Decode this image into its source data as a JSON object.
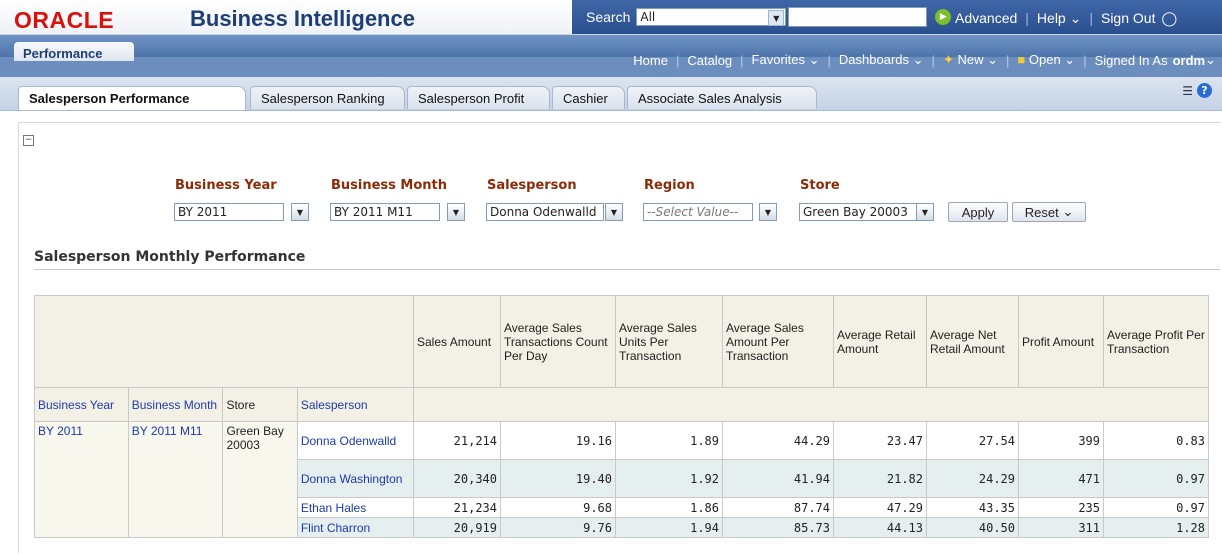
{
  "brand": {
    "logo": "ORACLE",
    "product": "Business Intelligence"
  },
  "search": {
    "label": "Search",
    "scope": "All",
    "value": ""
  },
  "top_links": {
    "advanced": "Advanced",
    "help": "Help",
    "sign_out": "Sign Out"
  },
  "nav": {
    "dashboard_title": "Performance",
    "home": "Home",
    "catalog": "Catalog",
    "favorites": "Favorites",
    "dashboards": "Dashboards",
    "new": "New",
    "open": "Open",
    "signed_in_as": "Signed In As",
    "user": "ordm"
  },
  "tabs": [
    {
      "label": "Salesperson Performance"
    },
    {
      "label": "Salesperson Ranking"
    },
    {
      "label": "Salesperson Profit"
    },
    {
      "label": "Cashier"
    },
    {
      "label": "Associate Sales Analysis"
    }
  ],
  "prompts": {
    "business_year": {
      "label": "Business Year",
      "value": "BY 2011"
    },
    "business_month": {
      "label": "Business Month",
      "value": "BY 2011 M11"
    },
    "salesperson": {
      "label": "Salesperson",
      "value": "Donna Odenwalld"
    },
    "region": {
      "label": "Region",
      "placeholder": "--Select Value--"
    },
    "store": {
      "label": "Store",
      "value": "Green Bay 20003"
    },
    "apply": "Apply",
    "reset": "Reset"
  },
  "section": {
    "title": "Salesperson Monthly Performance"
  },
  "table": {
    "measure_headers": [
      "Sales Amount",
      "Average Sales Transactions Count Per Day",
      "Average Sales Units Per Transaction",
      "Average Sales Amount Per Transaction",
      "Average Retail Amount",
      "Average Net Retail Amount",
      "Profit Amount",
      "Average Profit Per Transaction"
    ],
    "dim_headers": [
      "Business Year",
      "Business Month",
      "Store",
      "Salesperson"
    ],
    "business_year": "BY 2011",
    "business_month": "BY 2011 M11",
    "store": "Green Bay 20003",
    "rows": [
      {
        "salesperson": "Donna Odenwalld",
        "values": [
          "21,214",
          "19.16",
          "1.89",
          "44.29",
          "23.47",
          "27.54",
          "399",
          "0.83"
        ]
      },
      {
        "salesperson": "Donna Washington",
        "values": [
          "20,340",
          "19.40",
          "1.92",
          "41.94",
          "21.82",
          "24.29",
          "471",
          "0.97"
        ]
      },
      {
        "salesperson": "Ethan Hales",
        "values": [
          "21,234",
          "9.68",
          "1.86",
          "87.74",
          "47.29",
          "43.35",
          "235",
          "0.97"
        ]
      },
      {
        "salesperson": "Flint Charron",
        "values": [
          "20,919",
          "9.76",
          "1.94",
          "85.73",
          "44.13",
          "40.50",
          "311",
          "1.28"
        ]
      }
    ]
  },
  "colors": {
    "oracle_red": "#d8120b",
    "title_blue": "#1c3e74",
    "link_blue": "#1f3aa8",
    "prompt_label": "#8b2b08",
    "nav_blue": "#4d74aa"
  }
}
